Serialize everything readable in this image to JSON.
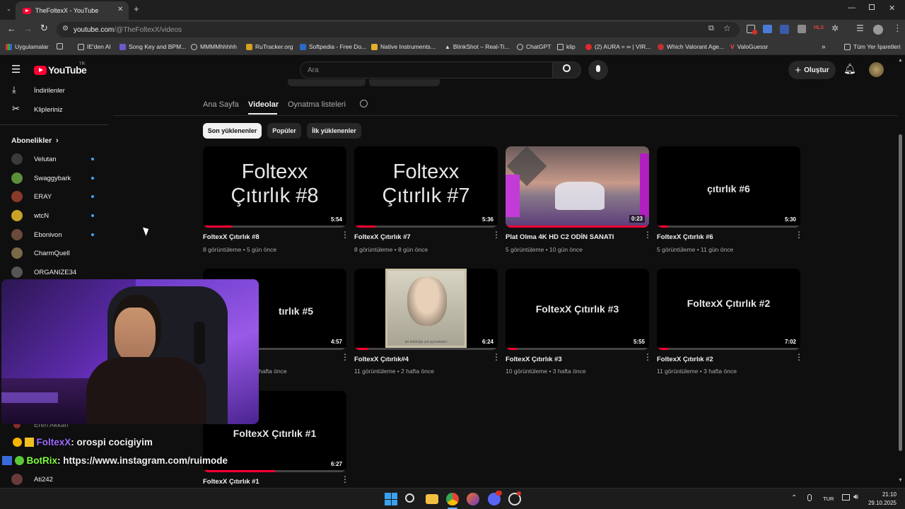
{
  "browser": {
    "tab_title": "TheFoltexX - YouTube",
    "url_host": "youtube.com",
    "url_path": "/@TheFoltexX/videos",
    "bookmarks": [
      "Uygulamalar",
      "IE'den Al",
      "Song Key and BPM...",
      "MMMMhhhhh",
      "RuTracker.org",
      "Softpedia - Free Do...",
      "Native Instruments...",
      "BlinkShot – Real-Ti...",
      "ChatGPT",
      "klip",
      "(2) AURA = ∞ | VIR...",
      "Which Valorant Age...",
      "ValoGuessr",
      "Tüm Yer İşaretleri"
    ]
  },
  "masthead": {
    "logo": "YouTube",
    "logo_country": "TR",
    "search_placeholder": "Ara",
    "create_label": "Oluştur"
  },
  "sidebar": {
    "items": [
      {
        "label": "İndirilenler",
        "icon": "download-icon"
      },
      {
        "label": "Klipleriniz",
        "icon": "scissors-icon"
      }
    ],
    "subs_header": "Abonelikler",
    "subscriptions": [
      {
        "name": "Velutan",
        "color": "#3a3a3a"
      },
      {
        "name": "Swaggybark",
        "color": "#5b8f3a"
      },
      {
        "name": "ERAY",
        "color": "#8a3a2a"
      },
      {
        "name": "wtcN",
        "color": "#c9a227"
      },
      {
        "name": "Ebonivon",
        "color": "#6a4a3a"
      },
      {
        "name": "CharmQuell",
        "color": "#7a6a4a"
      },
      {
        "name": "ORGANIZE34",
        "color": "#555555"
      }
    ],
    "partial": [
      "Eren Akkan",
      "Ati242"
    ]
  },
  "channel_tabs": [
    "Ana Sayfa",
    "Videolar",
    "Oynatma listeleri"
  ],
  "active_tab": "Videolar",
  "chips": [
    "Son yüklenenler",
    "Popüler",
    "İlk yüklenenler"
  ],
  "videos": [
    {
      "title": "FoltexX Çıtırlık #8",
      "views": "8 görüntüleme",
      "age": "5 gün önce",
      "duration": "5:54",
      "thumb_line1": "Foltexx",
      "thumb_line2": "Çıtırlık #8",
      "progress": 0.2
    },
    {
      "title": "FoltexX Çıtırlık #7",
      "views": "8 görüntüleme",
      "age": "8 gün önce",
      "duration": "5:36",
      "thumb_line1": "Foltexx",
      "thumb_line2": "Çıtırlık #7",
      "progress": 0.15
    },
    {
      "title": "Plat Olma 4K HD C2 ODİN SANATI",
      "views": "5 görüntüleme",
      "age": "10 gün önce",
      "duration": "0:23",
      "progress": 1.0
    },
    {
      "title": "FoltexX Çıtırlık #6",
      "views": "5 görüntüleme",
      "age": "11 gün önce",
      "duration": "5:30",
      "thumb_line1": "çıtırlık #6",
      "progress": 0.08
    },
    {
      "title": "",
      "views": "",
      "age": "hafta önce",
      "duration": "4:57",
      "thumb_line1": "tırlık #5",
      "progress": 0.05
    },
    {
      "title": "FoltexX Çıtırlık#4",
      "views": "11 görüntüleme",
      "age": "2 hafta önce",
      "duration": "6:24",
      "thumb_caption": "da farklılığa yol açmaktadır",
      "progress": 0.1
    },
    {
      "title": "FoltexX Çıtırlık #3",
      "views": "10 görüntüleme",
      "age": "3 hafta önce",
      "duration": "5:55",
      "thumb_line1": "FoltexX Çıtırlık #3",
      "progress": 0.08
    },
    {
      "title": "FoltexX Çıtırlık #2",
      "views": "11 görüntüleme",
      "age": "3 hafta önce",
      "duration": "7:02",
      "thumb_line1": "FoltexX Çıtırlık #2",
      "progress": 0.08
    },
    {
      "title": "FoltexX Çıtırlık #1",
      "views": "",
      "age": "",
      "duration": "6:27",
      "thumb_line1": "FoltexX Çıtırlık #1",
      "progress": 0.5
    }
  ],
  "chat": [
    {
      "user": "FoltexX",
      "msg": ": orospi cocigiyim",
      "user_color": "#9d6bff"
    },
    {
      "user": "BotRix",
      "msg": ": https://www.instagram.com/ruimode",
      "user_color": "#7fff3a"
    }
  ],
  "taskbar": {
    "lang": "TUR",
    "time": "21:10",
    "date": "29.10.2025"
  }
}
